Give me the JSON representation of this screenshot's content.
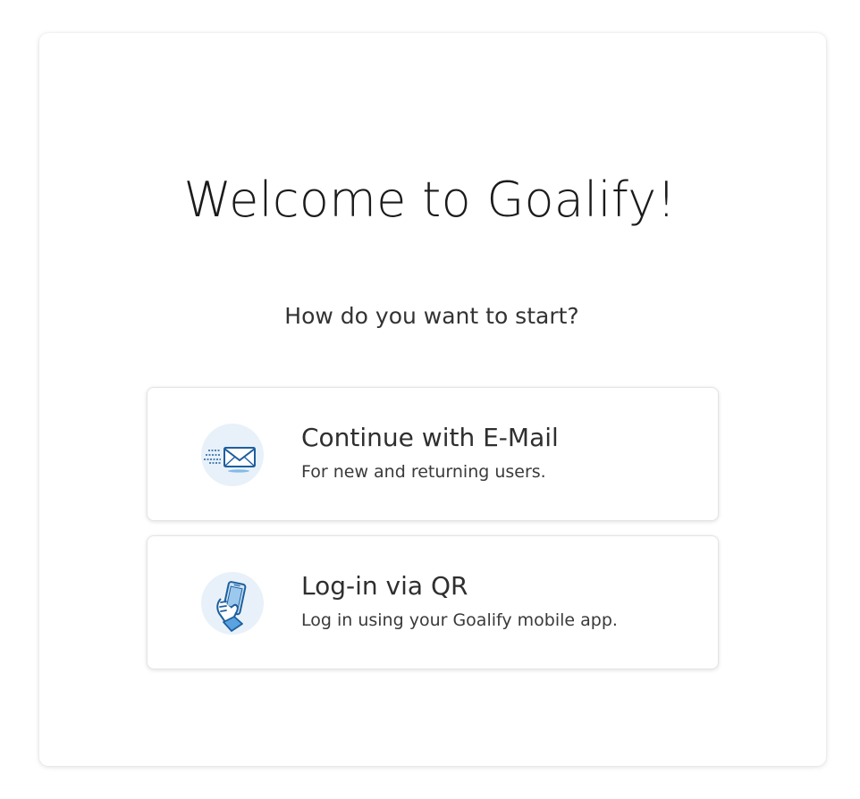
{
  "welcome": {
    "title": "Welcome to Goalify!",
    "subtitle": "How do you want to start?"
  },
  "options": [
    {
      "icon": "email-icon",
      "title": "Continue with E-Mail",
      "description": "For new and returning users."
    },
    {
      "icon": "phone-qr-icon",
      "title": "Log-in via QR",
      "description": "Log in using your Goalify mobile app."
    }
  ],
  "colors": {
    "icon_background": "#e8f1f9",
    "icon_primary": "#1e5f9e",
    "icon_light": "#5aa3e0"
  }
}
